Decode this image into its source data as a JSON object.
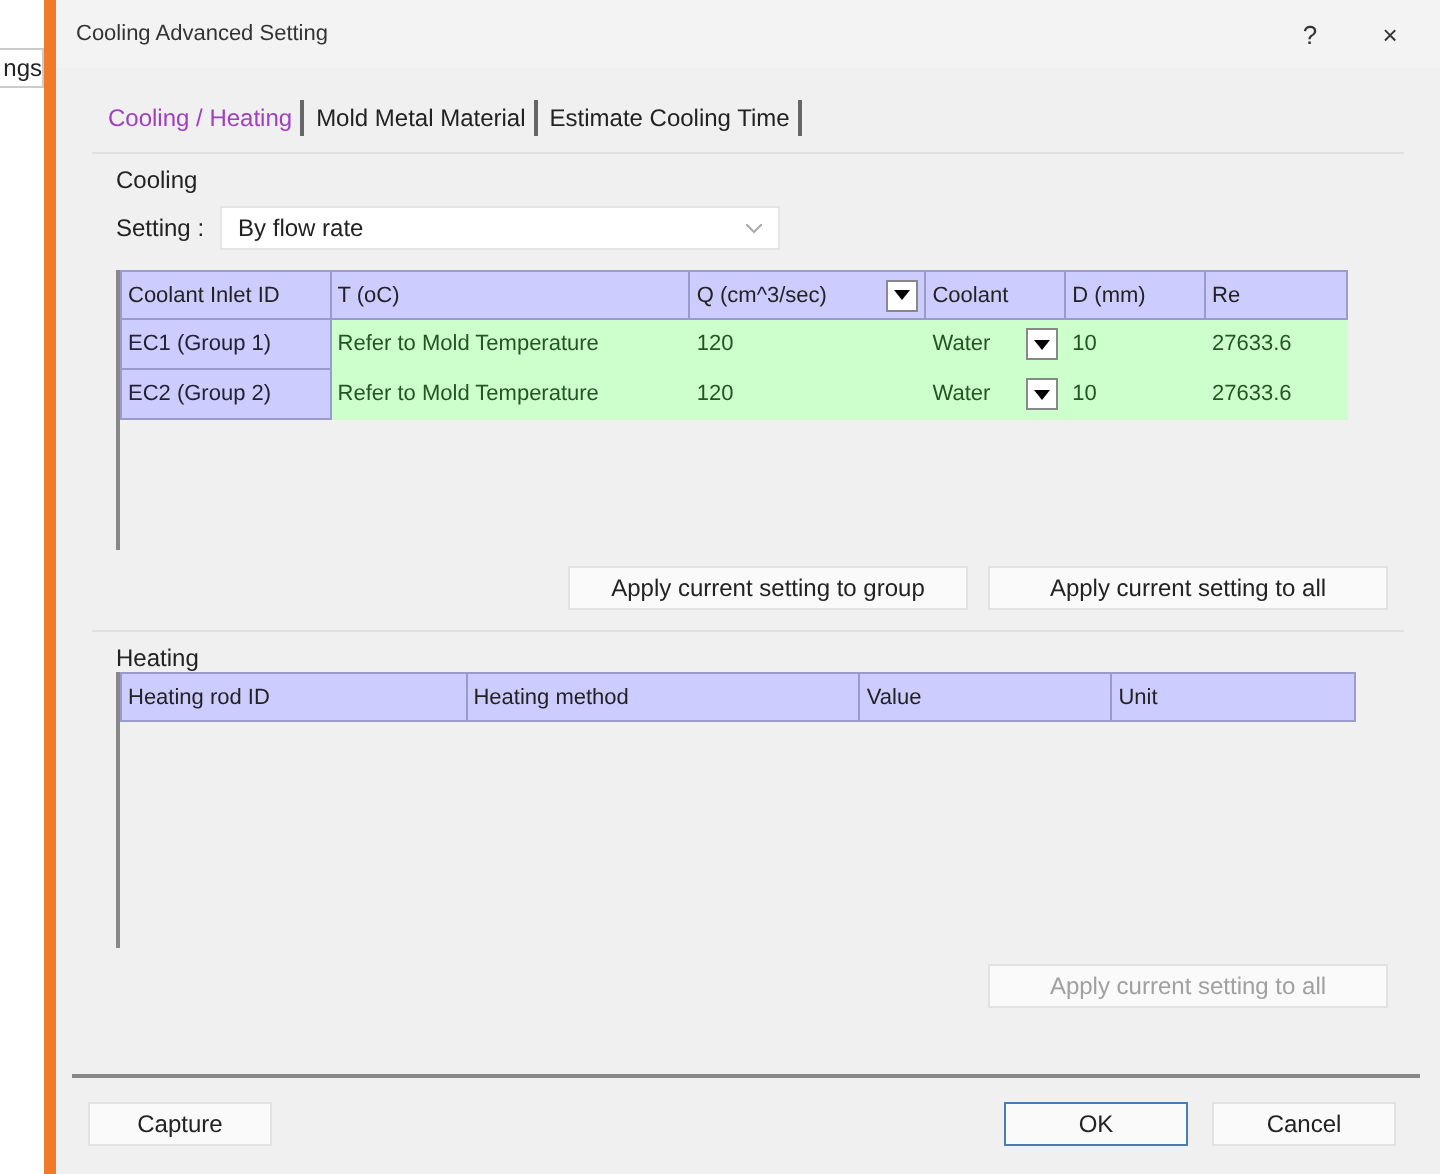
{
  "background": {
    "label": "ngs"
  },
  "window": {
    "title": "Cooling Advanced Setting",
    "help": "?",
    "close": "×"
  },
  "tabs": [
    {
      "label": "Cooling / Heating",
      "selected": true
    },
    {
      "label": "Mold Metal Material",
      "selected": false
    },
    {
      "label": "Estimate Cooling Time",
      "selected": false
    }
  ],
  "cooling": {
    "title": "Cooling",
    "setting_label": "Setting :",
    "setting_value": "By flow rate",
    "table": {
      "columns": [
        "Coolant Inlet ID",
        "T (oC)",
        "Q (cm^3/sec)",
        "Coolant",
        "D (mm)",
        "Re"
      ],
      "rows": [
        {
          "id": "EC1 (Group 1)",
          "t": "Refer to Mold Temperature",
          "q": "120",
          "coolant": "Water",
          "d": "10",
          "re": "27633.6"
        },
        {
          "id": "EC2 (Group 2)",
          "t": "Refer to Mold Temperature",
          "q": "120",
          "coolant": "Water",
          "d": "10",
          "re": "27633.6"
        }
      ]
    },
    "buttons": [
      "Apply current setting to group",
      "Apply current setting to all"
    ]
  },
  "heating": {
    "title": "Heating",
    "table": {
      "columns": [
        "Heating rod ID",
        "Heating method",
        "Value",
        "Unit"
      ]
    },
    "button": {
      "label": "Apply current setting to all",
      "disabled": true
    }
  },
  "footer": {
    "capture": "Capture",
    "ok": "OK",
    "cancel": "Cancel"
  }
}
